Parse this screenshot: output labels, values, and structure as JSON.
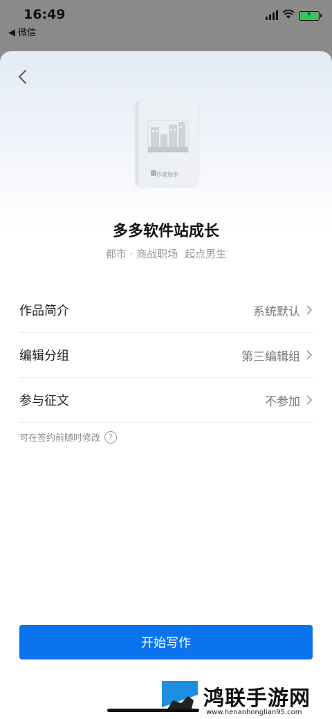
{
  "status_bar": {
    "time": "16:49",
    "back_app": "◀ 微信"
  },
  "sheet": {
    "cover_label": "作家助手",
    "book": {
      "title": "多多软件站成长",
      "category": "都市 · 商战职场",
      "channel": "起点男生"
    },
    "settings": [
      {
        "label": "作品简介",
        "value": "系统默认"
      },
      {
        "label": "编辑分组",
        "value": "第三编辑组"
      },
      {
        "label": "参与征文",
        "value": "不参加"
      }
    ],
    "hint": "可在签约前随时修改",
    "start_button": "开始写作"
  },
  "watermark": {
    "title": "鸿联手游网",
    "url": "www.henanhonglian95.com"
  },
  "colors": {
    "primary": "#0a74ee",
    "battery": "#34c759"
  }
}
